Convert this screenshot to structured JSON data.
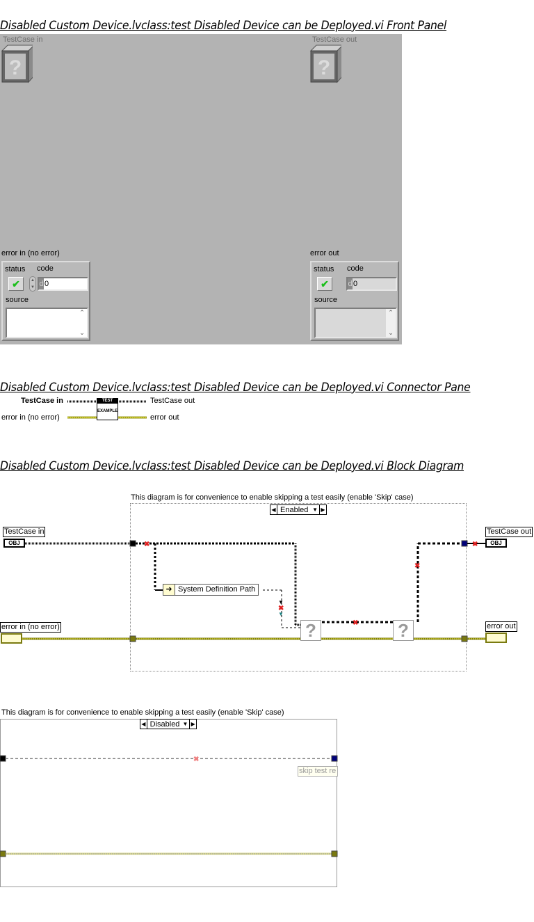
{
  "front_panel": {
    "title": "Disabled Custom Device.lvclass:test Disabled Device can be Deployed.vi Front Panel",
    "testcase_in_label": "TestCase in",
    "testcase_out_label": "TestCase out",
    "object_icon": "?",
    "error_in": {
      "label": "error in (no error)",
      "status_label": "status",
      "status_icon": "✔",
      "code_label": "code",
      "code_radix": "d",
      "code_value": "0",
      "source_label": "source",
      "source_value": ""
    },
    "error_out": {
      "label": "error out",
      "status_label": "status",
      "status_icon": "✔",
      "code_label": "code",
      "code_radix": "d",
      "code_value": "0",
      "source_label": "source",
      "source_value": ""
    }
  },
  "connector_pane": {
    "title": "Disabled Custom Device.lvclass:test Disabled Device can be Deployed.vi Connector Pane",
    "inputs": [
      "TestCase in",
      "error in (no error)"
    ],
    "outputs": [
      "TestCase out",
      "error out"
    ],
    "icon_top": "TEST",
    "icon_bottom": "EXAMPLE"
  },
  "block_diagram": {
    "title": "Disabled Custom Device.lvclass:test Disabled Device can be Deployed.vi Block Diagram",
    "enabled_case": {
      "comment": "This diagram is for convenience to enable skipping a test easily (enable 'Skip' case)",
      "selector": "Enabled",
      "testcase_in": "TestCase in",
      "error_in": "error in (no error)",
      "testcase_out": "TestCase out",
      "error_out": "error out",
      "property_node": "System Definition Path",
      "obj_terminal": "OBJ",
      "unknown_node_glyph": "?"
    },
    "disabled_case": {
      "comment": "This diagram is for convenience to enable skipping a test easily (enable 'Skip' case)",
      "selector": "Disabled",
      "skip_label": "skip test re"
    }
  },
  "colors": {
    "panel_bg": "#b3b3b3",
    "error_wire": "#9a9a1a",
    "class_wire": "#000000",
    "status_ok": "#1bbf1b",
    "error_tunnel": "#7a7a10",
    "class_tunnel_out": "#00007a"
  }
}
